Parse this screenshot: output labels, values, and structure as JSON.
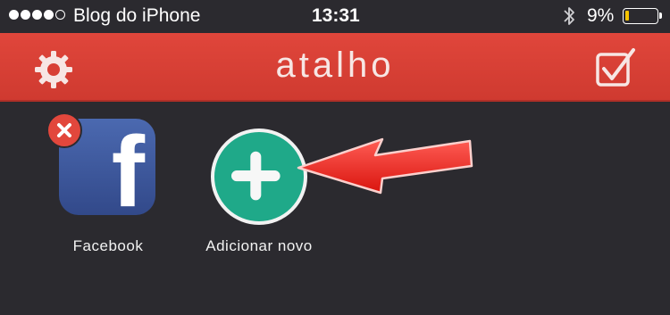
{
  "status_bar": {
    "carrier": "Blog do iPhone",
    "time": "13:31",
    "battery_percent": "9%",
    "battery_level": 0.09,
    "signal_bars": 4,
    "signal_total": 5,
    "icons": [
      "bluetooth-icon",
      "battery-icon"
    ]
  },
  "nav": {
    "title": "atalho",
    "left_icon": "gear-icon",
    "right_icon": "checkbox-icon"
  },
  "apps": [
    {
      "label": "Facebook",
      "icon": "facebook-icon",
      "badge": "delete-icon"
    },
    {
      "label": "Adicionar novo",
      "icon": "plus-icon"
    }
  ],
  "colors": {
    "background": "#2b2a2f",
    "nav_red": "#d83f35",
    "add_green": "#1fa989",
    "facebook_blue": "#3b5998",
    "arrow_red": "#e8231c"
  }
}
